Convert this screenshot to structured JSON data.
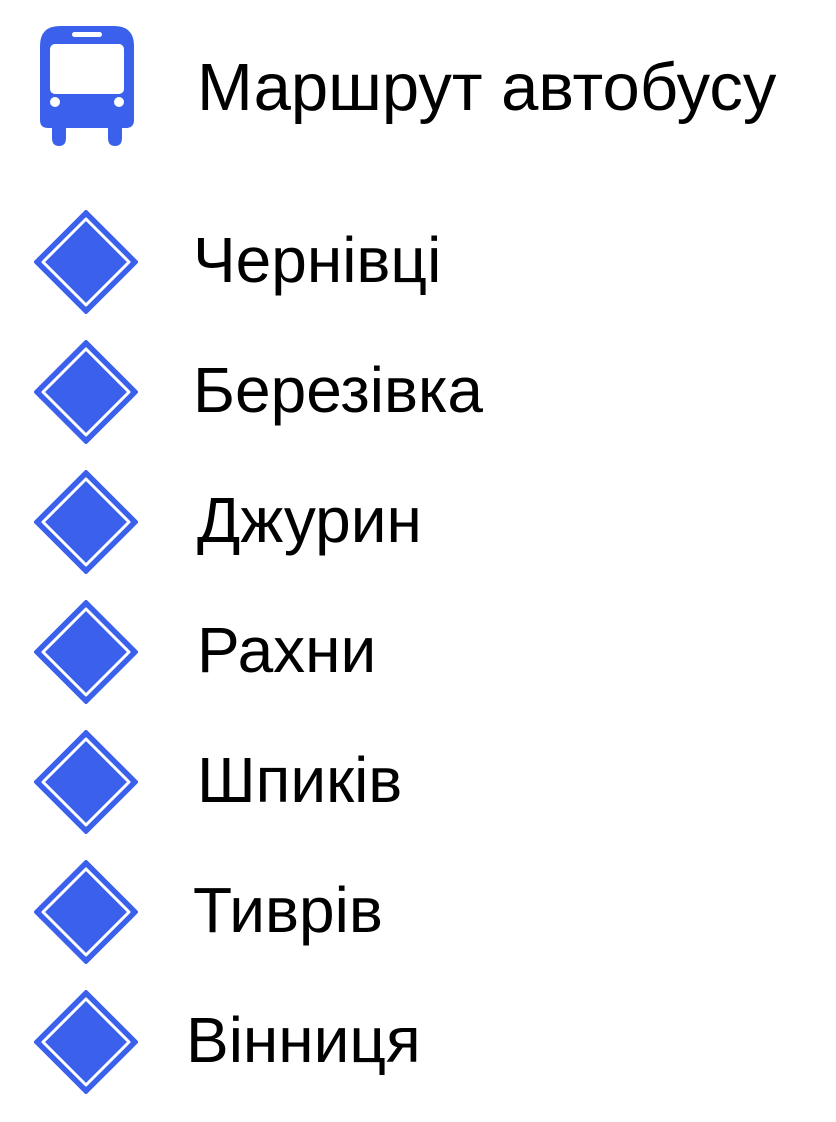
{
  "header": {
    "icon": "bus-icon",
    "title": "Маршрут автобусу"
  },
  "colors": {
    "accent": "#3b61ec",
    "text": "#000000",
    "background": "#ffffff"
  },
  "stops": [
    {
      "name": "Чернівці",
      "icon": "diamond-icon"
    },
    {
      "name": "Березівка",
      "icon": "diamond-icon"
    },
    {
      "name": "Джурин",
      "icon": "diamond-icon"
    },
    {
      "name": "Рахни",
      "icon": "diamond-icon"
    },
    {
      "name": "Шпиків",
      "icon": "diamond-icon"
    },
    {
      "name": "Тиврів",
      "icon": "diamond-icon"
    },
    {
      "name": "Вінниця",
      "icon": "diamond-icon"
    }
  ]
}
